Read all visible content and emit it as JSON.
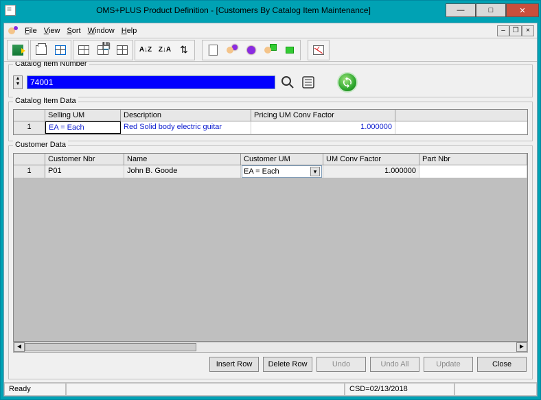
{
  "window": {
    "title": "OMS+PLUS Product Definition - [Customers By Catalog Item Maintenance]"
  },
  "menu": {
    "file": "File",
    "view": "View",
    "sort": "Sort",
    "window": "Window",
    "help": "Help"
  },
  "catalog": {
    "legend": "Catalog Item Number",
    "value": "74001"
  },
  "catalog_item_data": {
    "legend": "Catalog Item Data",
    "headers": {
      "selling_um": "Selling UM",
      "description": "Description",
      "pricing_factor": "Pricing UM Conv Factor"
    },
    "row": {
      "num": "1",
      "selling_um": "EA  = Each",
      "description": "Red Solid body electric guitar",
      "pricing_factor": "1.000000"
    }
  },
  "customer_data": {
    "legend": "Customer Data",
    "headers": {
      "customer_nbr": "Customer Nbr",
      "name": "Name",
      "customer_um": "Customer UM",
      "um_conv_factor": "UM Conv Factor",
      "part_nbr": "Part Nbr"
    },
    "row": {
      "num": "1",
      "customer_nbr": "P01",
      "name": "John B. Goode",
      "customer_um": "EA  = Each",
      "um_conv_factor": "1.000000",
      "part_nbr": ""
    }
  },
  "buttons": {
    "insert_row": "Insert Row",
    "delete_row": "Delete Row",
    "undo": "Undo",
    "undo_all": "Undo All",
    "update": "Update",
    "close": "Close"
  },
  "status": {
    "ready": "Ready",
    "csd": "CSD=02/13/2018"
  },
  "icons": {
    "minimize": "—",
    "maximize": "□",
    "close": "✕",
    "search": "🔍",
    "list": "☰",
    "sort_az": "A↓Z",
    "sort_za": "Z↓A",
    "updown": "⇅"
  }
}
